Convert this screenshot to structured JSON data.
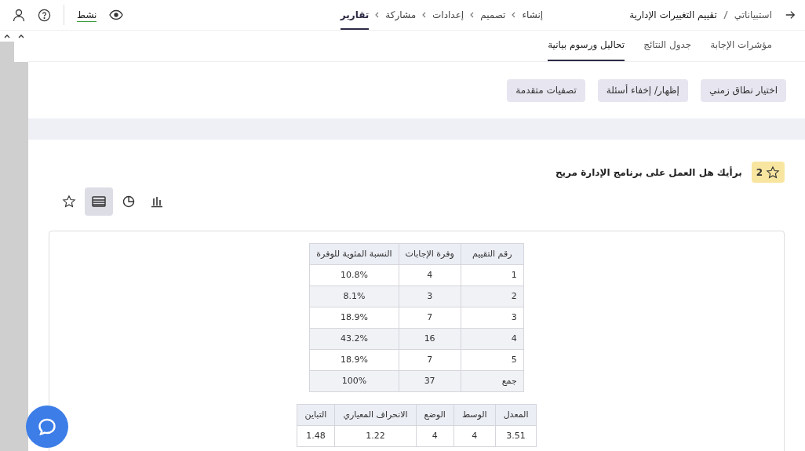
{
  "header": {
    "breadcrumb": [
      "استبياناتي",
      "تقييم التغييرات الإدارية"
    ],
    "steps": [
      {
        "label": "إنشاء",
        "selected": false
      },
      {
        "label": "تصميم",
        "selected": false
      },
      {
        "label": "إعدادات",
        "selected": false
      },
      {
        "label": "مشاركة",
        "selected": false
      },
      {
        "label": "تقارير",
        "selected": true
      }
    ],
    "status": "نشط"
  },
  "tabs": [
    {
      "label": "مؤشرات الإجابة",
      "selected": false
    },
    {
      "label": "جدول النتائج",
      "selected": false
    },
    {
      "label": "تحاليل ورسوم بيانية",
      "selected": true
    }
  ],
  "filters": [
    "اختيار نطاق زمني",
    "إظهار/ إخفاء أسئلة",
    "تصفيات متقدمة"
  ],
  "question": {
    "number": "2",
    "text": "برأيك هل العمل على برنامج الإدارة مريح"
  },
  "views": [
    {
      "kind": "bar",
      "selected": false
    },
    {
      "kind": "pie",
      "selected": false
    },
    {
      "kind": "table",
      "selected": true
    },
    {
      "kind": "star",
      "selected": false
    }
  ],
  "table": {
    "columns": [
      "رقم التقييم",
      "وفرة الإجابات",
      "النسبة المئوية للوفرة"
    ],
    "rows": [
      [
        "1",
        "4",
        "10.8%"
      ],
      [
        "2",
        "3",
        "8.1%"
      ],
      [
        "3",
        "7",
        "18.9%"
      ],
      [
        "4",
        "16",
        "43.2%"
      ],
      [
        "5",
        "7",
        "18.9%"
      ],
      [
        "جمع",
        "37",
        "100%"
      ]
    ]
  },
  "stats": {
    "columns": [
      "المعدل",
      "الوسط",
      "الوضع",
      "الانحراف المعياري",
      "التباين"
    ],
    "values": [
      "3.51",
      "4",
      "4",
      "1.22",
      "1.48"
    ]
  }
}
